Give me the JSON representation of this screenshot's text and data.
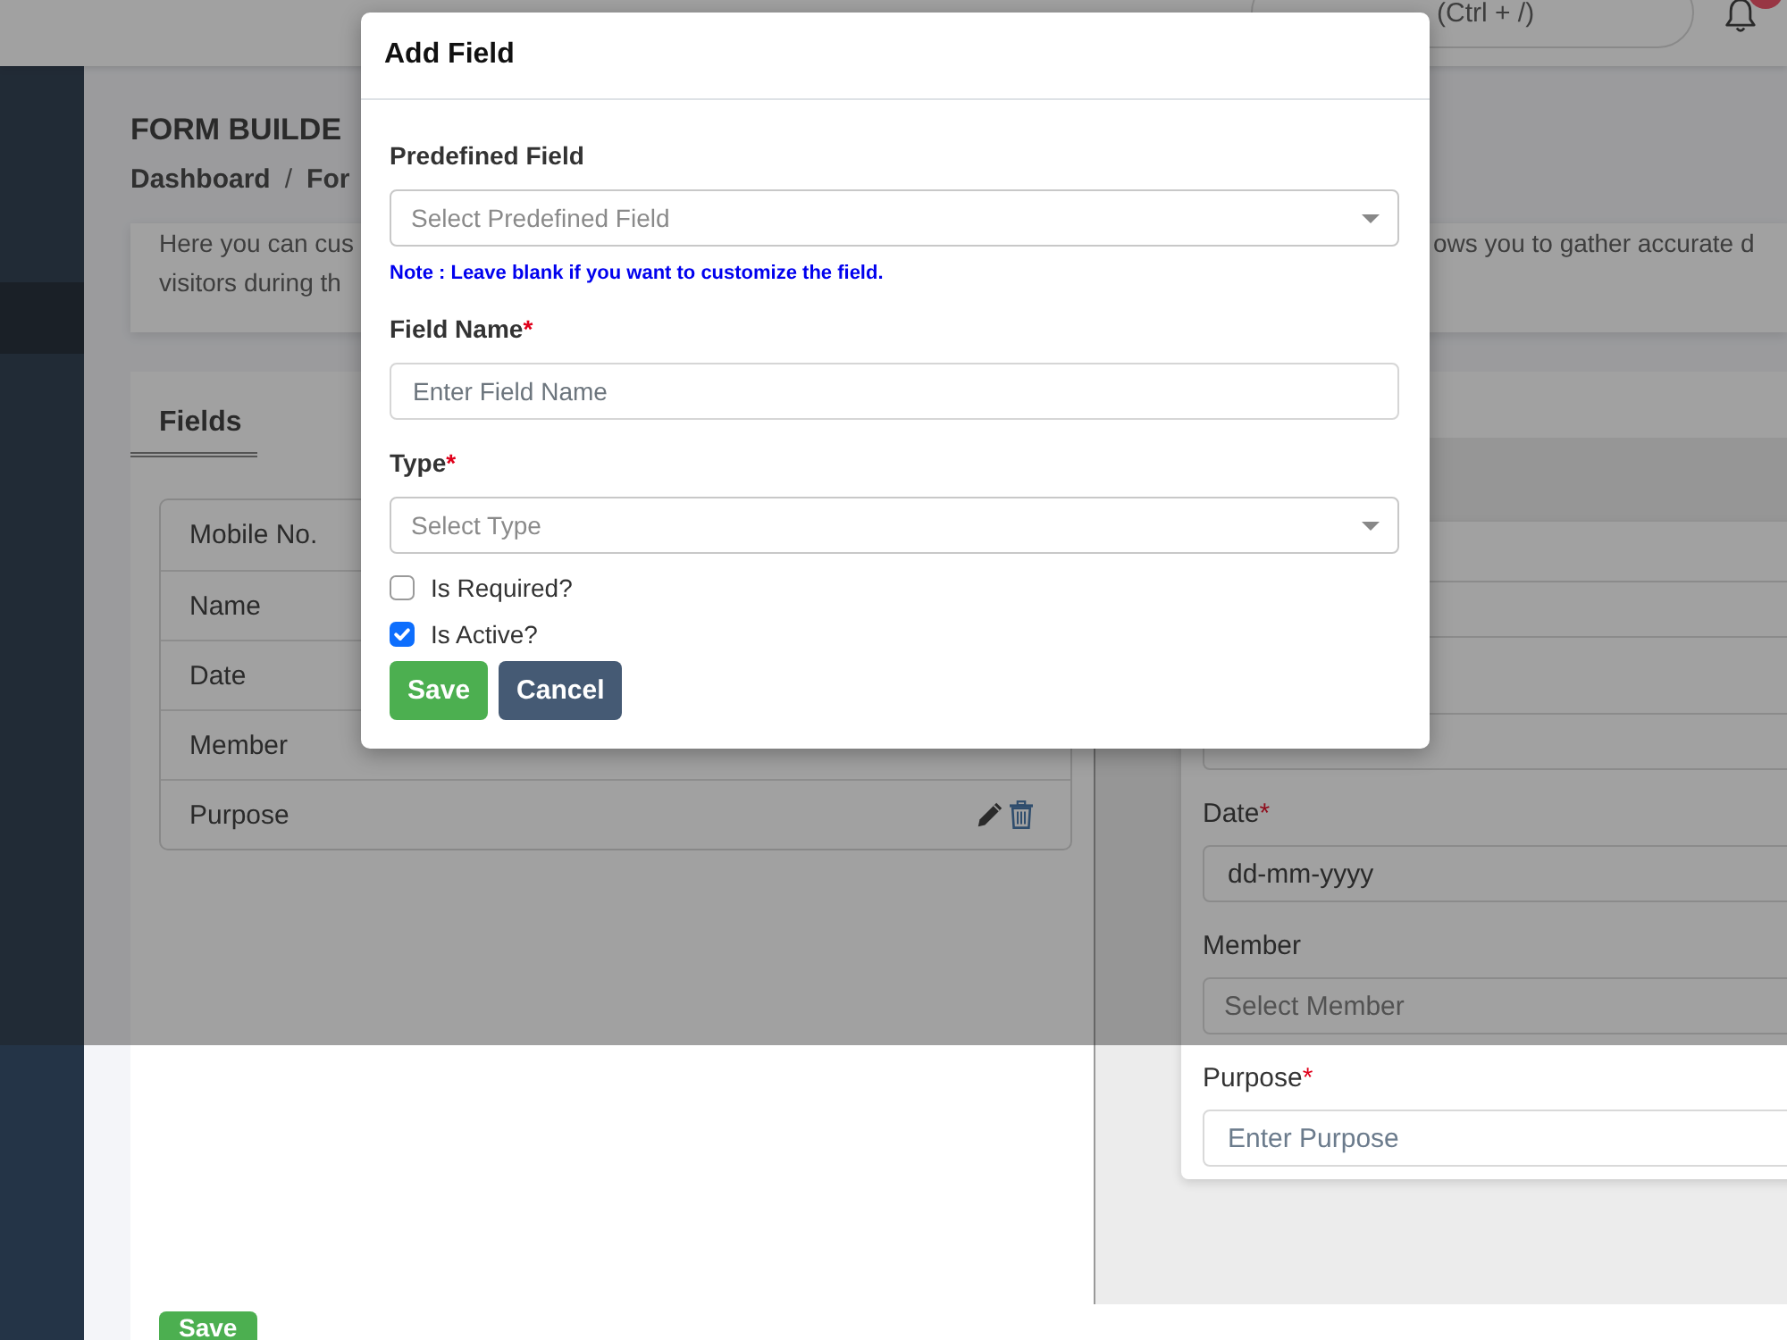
{
  "header": {
    "search": {
      "placeholder": "(Ctrl + /)"
    },
    "notification_badge": true
  },
  "sidebar": {
    "items": [
      {
        "selected": true
      }
    ]
  },
  "page": {
    "title": "FORM BUILDE",
    "breadcrumb": {
      "link": "Dashboard",
      "separator": "/",
      "current": "For"
    }
  },
  "description": {
    "left_lines": [
      "Here you can cus",
      "visitors during th"
    ],
    "right_lines": [
      "ows you to gather accurate d"
    ]
  },
  "fields_panel": {
    "tabs": [
      {
        "label": "Fields",
        "selected": true
      }
    ],
    "rows": [
      {
        "label": "Mobile No.",
        "actions": false
      },
      {
        "label": "Name",
        "actions": false
      },
      {
        "label": "Date",
        "actions": false
      },
      {
        "label": "Member",
        "actions": false
      },
      {
        "label": "Purpose",
        "actions": true
      }
    ]
  },
  "preview": {
    "fields": [
      {
        "kind": "text"
      },
      {
        "kind": "text"
      },
      {
        "kind": "date",
        "label": "Date",
        "required_mark": "*",
        "value": "dd-mm-yyyy"
      },
      {
        "kind": "select",
        "label": "Member",
        "placeholder": "Select Member"
      },
      {
        "kind": "text",
        "label": "Purpose",
        "required_mark": "*",
        "placeholder": "Enter Purpose"
      }
    ]
  },
  "footer": {
    "buttons": [
      {
        "label": "Save",
        "kind": "primary"
      }
    ]
  },
  "modal": {
    "title": "Add Field",
    "fields": [
      {
        "kind": "select",
        "label": "Predefined Field",
        "placeholder": "Select Predefined Field",
        "note": "Note : Leave blank if you want to customize the field."
      },
      {
        "kind": "text",
        "label": "Field Name",
        "required_mark": "*",
        "placeholder": "Enter Field Name"
      },
      {
        "kind": "select",
        "label": "Type",
        "required_mark": "*",
        "placeholder": "Select Type"
      }
    ],
    "checkboxes": [
      {
        "label": "Is Required?",
        "checked": false
      },
      {
        "label": "Is Active?",
        "checked": true
      }
    ],
    "buttons": [
      {
        "label": "Save",
        "kind": "primary"
      },
      {
        "label": "Cancel",
        "kind": "secondary"
      }
    ]
  }
}
